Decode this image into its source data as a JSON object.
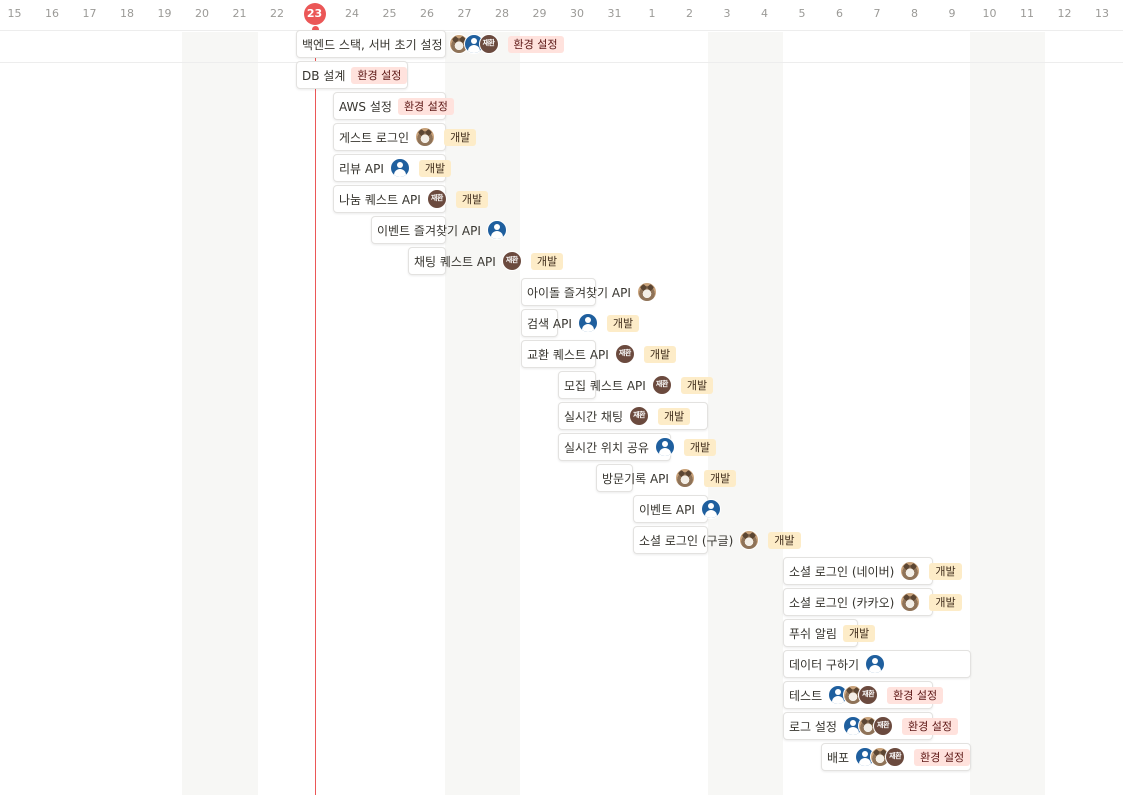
{
  "timeline": {
    "today": "23",
    "dates": [
      "15",
      "16",
      "17",
      "18",
      "19",
      "20",
      "21",
      "22",
      "23",
      "24",
      "25",
      "26",
      "27",
      "28",
      "29",
      "30",
      "31",
      "1",
      "2",
      "3",
      "4",
      "5",
      "6",
      "7",
      "8",
      "9",
      "10",
      "11",
      "12",
      "13"
    ]
  },
  "colors": {
    "today": "#eb5757",
    "tag_env_bg": "#ffe2dd",
    "tag_dev_bg": "#fdecc8",
    "avatar_blue": "#1f5f9e",
    "avatar_text_bg": "#6b4a3e"
  },
  "tasks": [
    {
      "name": "백엔드 스택, 서버 초기 설정",
      "assignees": [
        "cat",
        "blue",
        "text"
      ],
      "avatar_text": "재환",
      "tag": "환경 설정",
      "tag_type": "env"
    },
    {
      "name": "DB 설계",
      "assignees": [],
      "tag": "환경 설정",
      "tag_type": "env"
    },
    {
      "name": "AWS 설정",
      "assignees": [],
      "tag": "환경 설정",
      "tag_type": "env"
    },
    {
      "name": "게스트 로그인",
      "assignees": [
        "cat"
      ],
      "tag": "개발",
      "tag_type": "dev"
    },
    {
      "name": "리뷰 API",
      "assignees": [
        "blue"
      ],
      "tag": "개발",
      "tag_type": "dev"
    },
    {
      "name": "나눔 퀘스트 API",
      "assignees": [
        "text"
      ],
      "avatar_text": "재환",
      "tag": "개발",
      "tag_type": "dev"
    },
    {
      "name": "이벤트 즐겨찾기 API",
      "assignees": [
        "blue"
      ],
      "tag": "",
      "tag_type": ""
    },
    {
      "name": "채팅 퀘스트 API",
      "assignees": [
        "text"
      ],
      "avatar_text": "재환",
      "tag": "개발",
      "tag_type": "dev"
    },
    {
      "name": "아이돌 즐겨찾기 API",
      "assignees": [
        "cat"
      ],
      "tag": "",
      "tag_type": ""
    },
    {
      "name": "검색 API",
      "assignees": [
        "blue"
      ],
      "tag": "개발",
      "tag_type": "dev"
    },
    {
      "name": "교환 퀘스트 API",
      "assignees": [
        "text"
      ],
      "avatar_text": "재환",
      "tag": "개발",
      "tag_type": "dev"
    },
    {
      "name": "모집 퀘스트 API",
      "assignees": [
        "text"
      ],
      "avatar_text": "재환",
      "tag": "개발",
      "tag_type": "dev"
    },
    {
      "name": "실시간 채팅",
      "assignees": [
        "text"
      ],
      "avatar_text": "재환",
      "tag": "개발",
      "tag_type": "dev"
    },
    {
      "name": "실시간 위치 공유",
      "assignees": [
        "blue"
      ],
      "tag": "개발",
      "tag_type": "dev"
    },
    {
      "name": "방문기록 API",
      "assignees": [
        "cat"
      ],
      "tag": "개발",
      "tag_type": "dev"
    },
    {
      "name": "이벤트 API",
      "assignees": [
        "blue"
      ],
      "tag": "",
      "tag_type": ""
    },
    {
      "name": "소셜 로그인 (구글)",
      "assignees": [
        "cat"
      ],
      "tag": "개발",
      "tag_type": "dev"
    },
    {
      "name": "소셜 로그인 (네이버)",
      "assignees": [
        "cat"
      ],
      "tag": "개발",
      "tag_type": "dev"
    },
    {
      "name": "소셜 로그인 (카카오)",
      "assignees": [
        "cat"
      ],
      "tag": "개발",
      "tag_type": "dev"
    },
    {
      "name": "푸쉬 알림",
      "assignees": [],
      "tag": "개발",
      "tag_type": "dev"
    },
    {
      "name": "데이터 구하기",
      "assignees": [
        "blue"
      ],
      "tag": "",
      "tag_type": ""
    },
    {
      "name": "테스트",
      "assignees": [
        "blue",
        "cat",
        "text"
      ],
      "avatar_text": "재환",
      "tag": "환경 설정",
      "tag_type": "env"
    },
    {
      "name": "로그 설정",
      "assignees": [
        "blue",
        "cat",
        "text"
      ],
      "avatar_text": "재환",
      "tag": "환경 설정",
      "tag_type": "env"
    },
    {
      "name": "배포",
      "assignees": [
        "blue",
        "cat",
        "text"
      ],
      "avatar_text": "재환",
      "tag": "환경 설정",
      "tag_type": "env"
    }
  ]
}
